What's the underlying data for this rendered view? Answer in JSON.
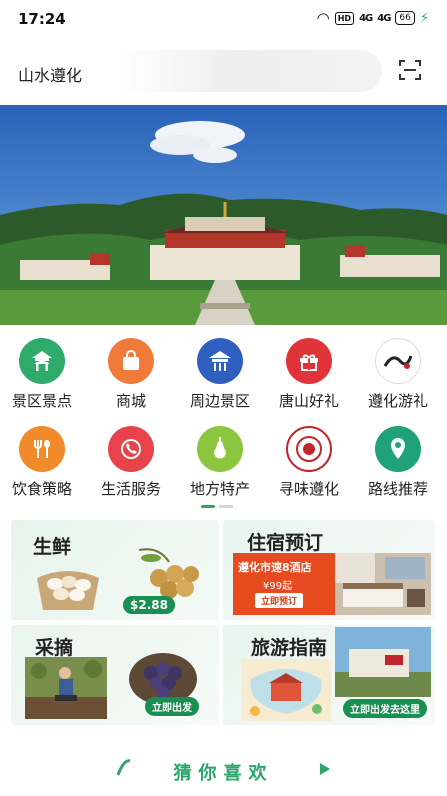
{
  "status_bar": {
    "time": "17:24",
    "hd": "HD",
    "signal1": "4G",
    "signal2": "4G",
    "battery": "66"
  },
  "header": {
    "search_text": "山水遵化",
    "scan_icon": "scan-icon"
  },
  "banner": {
    "scene": "temple-landscape"
  },
  "grid": [
    {
      "label": "景区景点",
      "icon": "pavilion-icon",
      "color": "#2eab6b"
    },
    {
      "label": "商城",
      "icon": "shopping-bag-icon",
      "color": "#f07a3a"
    },
    {
      "label": "周边景区",
      "icon": "temple-icon",
      "color": "#2f5fbf"
    },
    {
      "label": "唐山好礼",
      "icon": "gift-icon",
      "color": "#e0343a"
    },
    {
      "label": "遵化游礼",
      "icon": "travel-gift-logo",
      "color": "#222222"
    },
    {
      "label": "饮食策略",
      "icon": "fork-spoon-icon",
      "color": "#f08a2a"
    },
    {
      "label": "生活服务",
      "icon": "24h-phone-icon",
      "color": "#e8424a"
    },
    {
      "label": "地方特产",
      "icon": "pear-icon",
      "color": "#8cc63f"
    },
    {
      "label": "寻味遵化",
      "icon": "xunwei-logo",
      "color": "#c0262d"
    },
    {
      "label": "路线推荐",
      "icon": "location-pin-icon",
      "color": "#1fa27a"
    }
  ],
  "cards": {
    "fresh": {
      "title": "生鲜",
      "price_tag": "$2.88"
    },
    "hotel": {
      "title": "住宿预订",
      "hotel_name": "遵化市速8酒店",
      "price": "¥99起",
      "button": "立即预订"
    },
    "pick": {
      "title": "采摘",
      "button": "立即出发"
    },
    "guide": {
      "title": "旅游指南",
      "button": "立即出发去这里"
    }
  },
  "guess": {
    "title": "猜你喜欢"
  }
}
